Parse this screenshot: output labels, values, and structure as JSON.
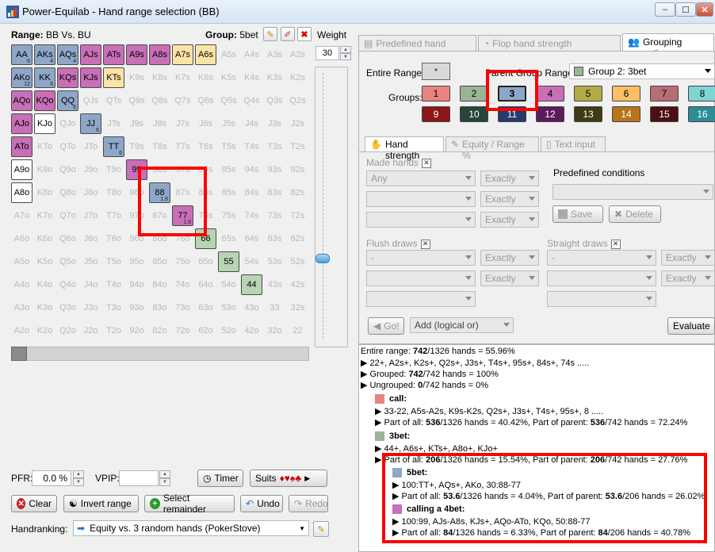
{
  "window": {
    "title": "Power-Equilab - Hand range selection (BB)",
    "buttons": [
      "–",
      "☐",
      "✕"
    ]
  },
  "header": {
    "range_label": "Range:",
    "range_value": "BB Vs. BU",
    "group_label": "Group:",
    "group_value": "5bet",
    "weight_label": "Weight",
    "weight_value": "30"
  },
  "colors": {
    "blue": "#8ea7c9",
    "purple": "#c86fb7",
    "cream": "#fbe3a8",
    "green": "#b8d4b4",
    "white": "#ffffff"
  },
  "grid": [
    [
      {
        "t": "AA",
        "c": "blue",
        "s": "6"
      },
      {
        "t": "AKs",
        "c": "blue",
        "s": "4"
      },
      {
        "t": "AQs",
        "c": "blue",
        "s": "4"
      },
      {
        "t": "AJs",
        "c": "purple"
      },
      {
        "t": "ATs",
        "c": "purple"
      },
      {
        "t": "A9s",
        "c": "purple"
      },
      {
        "t": "A8s",
        "c": "purple"
      },
      {
        "t": "A7s",
        "c": "cream"
      },
      {
        "t": "A6s",
        "c": "cream"
      },
      {
        "t": "A5s"
      },
      {
        "t": "A4s"
      },
      {
        "t": "A3s"
      },
      {
        "t": "A2s"
      }
    ],
    [
      {
        "t": "AKo",
        "c": "blue",
        "s": "12"
      },
      {
        "t": "KK",
        "c": "blue",
        "s": "6"
      },
      {
        "t": "KQs",
        "c": "purple"
      },
      {
        "t": "KJs",
        "c": "purple"
      },
      {
        "t": "KTs",
        "c": "cream"
      },
      {
        "t": "K9s"
      },
      {
        "t": "K8s"
      },
      {
        "t": "K7s"
      },
      {
        "t": "K6s"
      },
      {
        "t": "K5s"
      },
      {
        "t": "K4s"
      },
      {
        "t": "K3s"
      },
      {
        "t": "K2s"
      }
    ],
    [
      {
        "t": "AQo",
        "c": "purple"
      },
      {
        "t": "KQo",
        "c": "purple"
      },
      {
        "t": "QQ",
        "c": "blue",
        "s": "6"
      },
      {
        "t": "QJs"
      },
      {
        "t": "QTs"
      },
      {
        "t": "Q9s"
      },
      {
        "t": "Q8s"
      },
      {
        "t": "Q7s"
      },
      {
        "t": "Q6s"
      },
      {
        "t": "Q5s"
      },
      {
        "t": "Q4s"
      },
      {
        "t": "Q3s"
      },
      {
        "t": "Q2s"
      }
    ],
    [
      {
        "t": "AJo",
        "c": "purple"
      },
      {
        "t": "KJo",
        "c": "white"
      },
      {
        "t": "QJo"
      },
      {
        "t": "JJ",
        "c": "blue",
        "s": "6"
      },
      {
        "t": "JTs"
      },
      {
        "t": "J9s"
      },
      {
        "t": "J8s"
      },
      {
        "t": "J7s"
      },
      {
        "t": "J6s"
      },
      {
        "t": "J5s"
      },
      {
        "t": "J4s"
      },
      {
        "t": "J3s"
      },
      {
        "t": "J2s"
      }
    ],
    [
      {
        "t": "ATo",
        "c": "purple"
      },
      {
        "t": "KTo"
      },
      {
        "t": "QTo"
      },
      {
        "t": "JTo"
      },
      {
        "t": "TT",
        "c": "blue",
        "s": "6"
      },
      {
        "t": "T9s"
      },
      {
        "t": "T8s"
      },
      {
        "t": "T7s"
      },
      {
        "t": "T6s"
      },
      {
        "t": "T5s"
      },
      {
        "t": "T4s"
      },
      {
        "t": "T3s"
      },
      {
        "t": "T2s"
      }
    ],
    [
      {
        "t": "A9o",
        "c": "white"
      },
      {
        "t": "K9o"
      },
      {
        "t": "Q9o"
      },
      {
        "t": "J9o"
      },
      {
        "t": "T9o"
      },
      {
        "t": "99",
        "c": "purple"
      },
      {
        "t": "98s"
      },
      {
        "t": "97s"
      },
      {
        "t": "96s"
      },
      {
        "t": "95s"
      },
      {
        "t": "94s"
      },
      {
        "t": "93s"
      },
      {
        "t": "92s"
      }
    ],
    [
      {
        "t": "A8o",
        "c": "white"
      },
      {
        "t": "K8o"
      },
      {
        "t": "Q8o"
      },
      {
        "t": "J8o"
      },
      {
        "t": "T8o"
      },
      {
        "t": "98o"
      },
      {
        "t": "88",
        "c": "blue",
        "s": "1.8"
      },
      {
        "t": "87s"
      },
      {
        "t": "86s"
      },
      {
        "t": "85s"
      },
      {
        "t": "84s"
      },
      {
        "t": "83s"
      },
      {
        "t": "82s"
      }
    ],
    [
      {
        "t": "A7o"
      },
      {
        "t": "K7o"
      },
      {
        "t": "Q7o"
      },
      {
        "t": "J7o"
      },
      {
        "t": "T7o"
      },
      {
        "t": "97o"
      },
      {
        "t": "87o"
      },
      {
        "t": "77",
        "c": "purple",
        "s": "1.8"
      },
      {
        "t": "76s"
      },
      {
        "t": "75s"
      },
      {
        "t": "74s"
      },
      {
        "t": "73s"
      },
      {
        "t": "72s"
      }
    ],
    [
      {
        "t": "A6o"
      },
      {
        "t": "K6o"
      },
      {
        "t": "Q6o"
      },
      {
        "t": "J6o"
      },
      {
        "t": "T6o"
      },
      {
        "t": "96o"
      },
      {
        "t": "86o"
      },
      {
        "t": "76o"
      },
      {
        "t": "66",
        "c": "green"
      },
      {
        "t": "65s"
      },
      {
        "t": "64s"
      },
      {
        "t": "63s"
      },
      {
        "t": "62s"
      }
    ],
    [
      {
        "t": "A5o"
      },
      {
        "t": "K5o"
      },
      {
        "t": "Q5o"
      },
      {
        "t": "J5o"
      },
      {
        "t": "T5o"
      },
      {
        "t": "95o"
      },
      {
        "t": "85o"
      },
      {
        "t": "75o"
      },
      {
        "t": "65o"
      },
      {
        "t": "55",
        "c": "green"
      },
      {
        "t": "54s"
      },
      {
        "t": "53s"
      },
      {
        "t": "52s"
      }
    ],
    [
      {
        "t": "A4o"
      },
      {
        "t": "K4o"
      },
      {
        "t": "Q4o"
      },
      {
        "t": "J4o"
      },
      {
        "t": "T4o"
      },
      {
        "t": "94o"
      },
      {
        "t": "84o"
      },
      {
        "t": "74o"
      },
      {
        "t": "64o"
      },
      {
        "t": "54o"
      },
      {
        "t": "44",
        "c": "green"
      },
      {
        "t": "43s"
      },
      {
        "t": "42s"
      }
    ],
    [
      {
        "t": "A3o"
      },
      {
        "t": "K3o"
      },
      {
        "t": "Q3o"
      },
      {
        "t": "J3o"
      },
      {
        "t": "T3o"
      },
      {
        "t": "93o"
      },
      {
        "t": "83o"
      },
      {
        "t": "73o"
      },
      {
        "t": "63o"
      },
      {
        "t": "53o"
      },
      {
        "t": "43o"
      },
      {
        "t": "33"
      },
      {
        "t": "32s"
      }
    ],
    [
      {
        "t": "A2o"
      },
      {
        "t": "K2o"
      },
      {
        "t": "Q2o"
      },
      {
        "t": "J2o"
      },
      {
        "t": "T2o"
      },
      {
        "t": "92o"
      },
      {
        "t": "82o"
      },
      {
        "t": "72o"
      },
      {
        "t": "62o"
      },
      {
        "t": "52o"
      },
      {
        "t": "42o"
      },
      {
        "t": "32o"
      },
      {
        "t": "22"
      }
    ]
  ],
  "bottom": {
    "pfr_label": "PFR:",
    "pfr_value": "0.0 %",
    "vpip_label": "VPIP:",
    "vpip_value": "",
    "timer": "Timer",
    "suits": "Suits",
    "suit_symbols": "♦♥♠♣",
    "clear": "Clear",
    "invert": "Invert range",
    "select_remainder": "Select remainder",
    "undo": "Undo",
    "redo": "Redo",
    "handranking_label": "Handranking:",
    "handranking_value": "Equity vs. 3 random hands (PokerStove)"
  },
  "tabs": {
    "predefined": "Predefined hand ranges",
    "flop": "Flop hand strength distribution",
    "grouping": "Grouping options"
  },
  "grouping": {
    "entire_range_label": "Entire Range:",
    "entire_range_btn": "*",
    "parent_label": "Parent Group Range:",
    "parent_value": "Group 2: 3bet",
    "groups_label": "Groups:",
    "groups": [
      {
        "n": "1",
        "bg": "#e9837e",
        "fg": "#000"
      },
      {
        "n": "2",
        "bg": "#9bb497",
        "fg": "#000"
      },
      {
        "n": "3",
        "bg": "#8ea7c9",
        "fg": "#000"
      },
      {
        "n": "4",
        "bg": "#c86fb7",
        "fg": "#000"
      },
      {
        "n": "5",
        "bg": "#b3ac46",
        "fg": "#000"
      },
      {
        "n": "6",
        "bg": "#fbbf65",
        "fg": "#000"
      },
      {
        "n": "7",
        "bg": "#b86c74",
        "fg": "#000"
      },
      {
        "n": "8",
        "bg": "#7fd4d4",
        "fg": "#000"
      },
      {
        "n": "9",
        "bg": "#8e1616",
        "fg": "#fff"
      },
      {
        "n": "10",
        "bg": "#27443a",
        "fg": "#fff"
      },
      {
        "n": "11",
        "bg": "#273a6e",
        "fg": "#fff"
      },
      {
        "n": "12",
        "bg": "#5d1a5d",
        "fg": "#fff"
      },
      {
        "n": "13",
        "bg": "#3e3b12",
        "fg": "#fff"
      },
      {
        "n": "14",
        "bg": "#b8741c",
        "fg": "#fff"
      },
      {
        "n": "15",
        "bg": "#4b1016",
        "fg": "#fff"
      },
      {
        "n": "16",
        "bg": "#2b8d95",
        "fg": "#fff"
      }
    ]
  },
  "subtabs": {
    "hand_strength": "Hand strength",
    "equity": "Equity / Range %",
    "text_input": "Text input"
  },
  "filters": {
    "made_hands": "Made hands",
    "any": "Any",
    "exactly": "Exactly",
    "predefined_conditions": "Predefined conditions",
    "save": "Save",
    "delete": "Delete",
    "flush_draws": "Flush draws",
    "straight_draws": "Straight draws",
    "dash": "-",
    "go": "Go!",
    "add_logical": "Add (logical or)",
    "evaluate": "Evaluate"
  },
  "info": {
    "entire": "Entire range: ",
    "entire_b": "742",
    "entire_rest": "/1326 hands = 55.96%",
    "l1": "22+, A2s+, K2s+, Q2s+, J3s+, T4s+, 95s+, 84s+, 74s .....",
    "l2a": "Grouped: ",
    "l2b": "742",
    "l2c": "/742 hands = 100%",
    "l3a": "Ungrouped: ",
    "l3b": "0",
    "l3c": "/742 hands = 0%",
    "call_name": "call:",
    "call_color": "#e9837e",
    "call_l1": "33-22, A5s-A2s, K9s-K2s, Q2s+, J3s+, T4s+, 95s+, 8 .....",
    "call_l2": [
      "Part of all: ",
      "536",
      "/1326 hands = 40.42%, Part of parent: ",
      "536",
      "/742 hands = 72.24%"
    ],
    "bet3_name": "3bet:",
    "bet3_color": "#9bb497",
    "bet3_l1": "44+, A6s+, KTs+, A8o+, KJo+",
    "bet3_l2": [
      "Part of all: ",
      "206",
      "/1326 hands = 15.54%, Part of parent: ",
      "206",
      "/742 hands = 27.76%"
    ],
    "bet5_name": "5bet:",
    "bet5_color": "#8ea7c9",
    "bet5_l1": "100:TT+, AQs+, AKo, 30:88-77",
    "bet5_l2": [
      "Part of all: ",
      "53.6",
      "/1326 hands = 4.04%, Part of parent: ",
      "53.6",
      "/206 hands = 26.02%"
    ],
    "call4_name": "calling a 4bet:",
    "call4_color": "#c86fb7",
    "call4_l1": "100:99, AJs-A8s, KJs+, AQo-ATo, KQo, 50:88-77",
    "call4_l2": [
      "Part of all: ",
      "84",
      "/1326 hands = 6.33%, Part of parent: ",
      "84",
      "/206 hands = 40.78%"
    ]
  }
}
